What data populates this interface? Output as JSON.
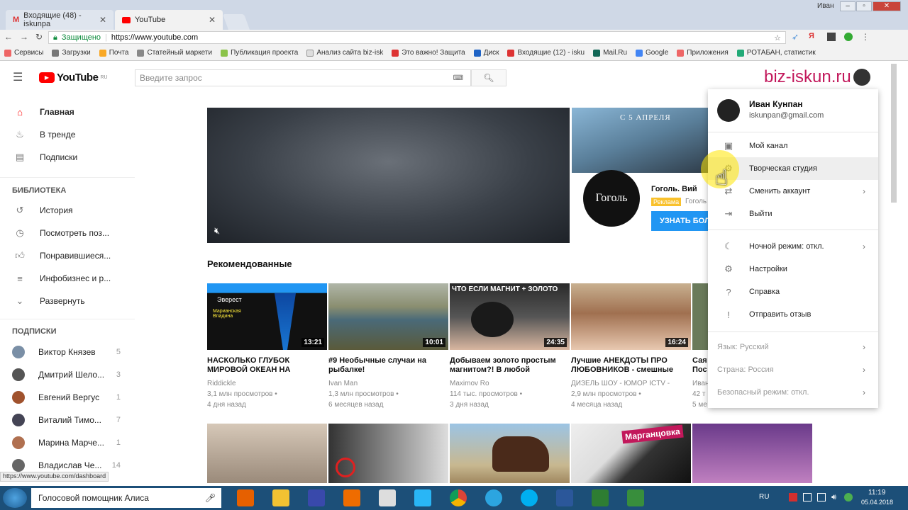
{
  "browser": {
    "tabs": [
      {
        "label": "Входящие (48) - iskunpa"
      },
      {
        "label": "YouTube"
      }
    ],
    "window_user": "Иван",
    "secure_label": "Защищено",
    "url": "https://www.youtube.com",
    "bookmarks": [
      "Сервисы",
      "Загрузки",
      "Почта",
      "Статейный маркети",
      "Публикация проекта",
      "Анализ сайта biz-isk",
      "Это важно! Защита",
      "Диск",
      "Входящие (12) - isku",
      "Mail.Ru",
      "Google",
      "Приложения",
      "РОТАБАН, статистик"
    ]
  },
  "header": {
    "logo": "YouTube",
    "logo_region": "RU",
    "search_placeholder": "Введите запрос",
    "watermark": "biz-iskun.ru"
  },
  "sidebar": {
    "main": [
      {
        "label": "Главная",
        "icon": "home-icon"
      },
      {
        "label": "В тренде",
        "icon": "fire-icon"
      },
      {
        "label": "Подписки",
        "icon": "subscriptions-icon"
      }
    ],
    "library_title": "БИБЛИОТЕКА",
    "library": [
      {
        "label": "История",
        "icon": "history-icon"
      },
      {
        "label": "Посмотреть поз...",
        "icon": "clock-icon"
      },
      {
        "label": "Понравившиеся...",
        "icon": "thumbs-up-icon"
      },
      {
        "label": "Инфобизнес и р...",
        "icon": "playlist-icon"
      },
      {
        "label": "Развернуть",
        "icon": "chevron-down-icon"
      }
    ],
    "subs_title": "ПОДПИСКИ",
    "subs": [
      {
        "label": "Виктор Князев",
        "count": "5"
      },
      {
        "label": "Дмитрий Шело...",
        "count": "3"
      },
      {
        "label": "Евгений Вергус",
        "count": "1"
      },
      {
        "label": "Виталий Тимо...",
        "count": "7"
      },
      {
        "label": "Марина Марче...",
        "count": "1"
      },
      {
        "label": "Владислав Че...",
        "count": "14"
      }
    ]
  },
  "ad": {
    "banner_text": "С 5 АПРЕЛЯ",
    "logo_text": "Гоголь",
    "title": "Гоголь. Вий",
    "badge": "Реклама",
    "channel": "Гоголь",
    "cta": "УЗНАТЬ БОЛ"
  },
  "section_title": "Рекомендованные",
  "videos": [
    {
      "title1": "НАСКОЛЬКО ГЛУБОК",
      "title2": "МИРОВОЙ ОКЕАН НА",
      "channel": "Riddickle",
      "views": "3,1 млн просмотров •",
      "age": "4 дня назад",
      "duration": "13:21",
      "overlay1": "Эверест",
      "overlay2": "Марианская Впадина"
    },
    {
      "title1": "#9 Необычные случаи на",
      "title2": "рыбалке!",
      "channel": "Ivan Man",
      "views": "1,3 млн просмотров •",
      "age": "6 месяцев назад",
      "duration": "10:01"
    },
    {
      "title1": "Добываем золото простым",
      "title2": "магнитом?! В любой",
      "channel": "Maximov Ro",
      "views": "114 тыс. просмотров •",
      "age": "3 дня назад",
      "duration": "24:35",
      "overlay1": "ЧТО ЕСЛИ МАГНИТ + ЗОЛОТО"
    },
    {
      "title1": "Лучшие АНЕКДОТЫ ПРО",
      "title2": "ЛЮБОВНИКОВ - смешные",
      "channel": "ДИЗЕЛЬ ШОУ - ЮМОР ICTV -",
      "views": "2,9 млн просмотров •",
      "age": "4 месяца назад",
      "duration": "16:24"
    },
    {
      "title1": "Сая",
      "title2": "Пос",
      "channel": "Иван",
      "views": "42 т",
      "age": "5 ме",
      "duration": ""
    }
  ],
  "row2_overlay": "Марганцовка",
  "menu": {
    "user_name": "Иван Кунпан",
    "user_email": "iskunpan@gmail.com",
    "items": [
      {
        "label": "Мой канал",
        "icon": "person-icon"
      },
      {
        "label": "Творческая студия",
        "icon": "gear-icon"
      },
      {
        "label": "Сменить аккаунт",
        "icon": "switch-icon"
      },
      {
        "label": "Выйти",
        "icon": "logout-icon"
      },
      {
        "label": "Ночной режим: откл.",
        "icon": "moon-icon"
      },
      {
        "label": "Настройки",
        "icon": "settings-icon"
      },
      {
        "label": "Справка",
        "icon": "help-icon"
      },
      {
        "label": "Отправить отзыв",
        "icon": "feedback-icon"
      }
    ],
    "footer": [
      "Язык: Русский",
      "Страна: Россия",
      "Безопасный режим: откл."
    ]
  },
  "status_url": "https://www.youtube.com/dashboard",
  "taskbar": {
    "assistant": "Голосовой помощник Алиса",
    "lang": "RU",
    "time": "11:19",
    "date": "05.04.2018"
  },
  "colors": {
    "yt_red": "#ff0000",
    "ad_button": "#2196f3",
    "badge": "#f9c12c",
    "watermark": "#c2185b"
  }
}
